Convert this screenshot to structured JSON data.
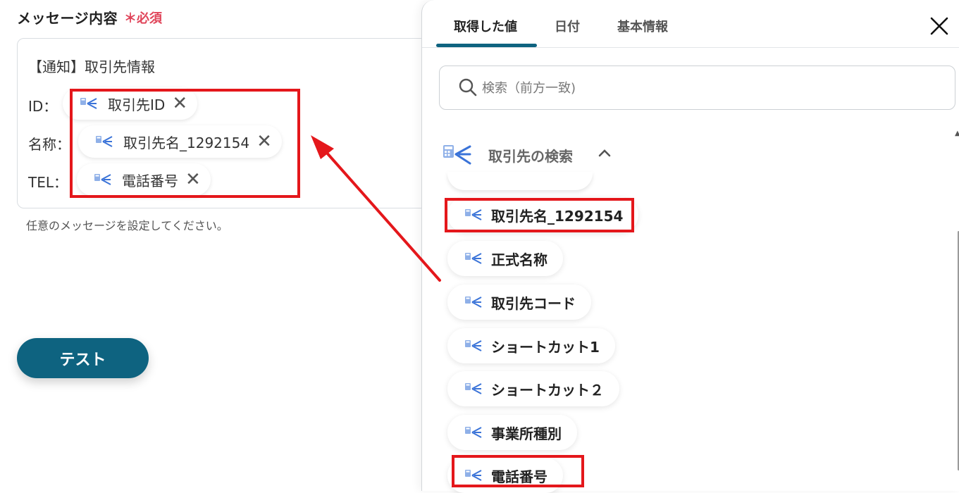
{
  "form": {
    "label": "メッセージ内容",
    "required_mark": "＊必須",
    "message_lines": [
      {
        "text": "【通知】取引先情報"
      },
      {
        "prefix": "ID：",
        "chip": "取引先ID"
      },
      {
        "prefix": "名称：",
        "chip": "取引先名_1292154"
      },
      {
        "prefix": "TEL：",
        "chip": "電話番号"
      }
    ],
    "hint": "任意のメッセージを設定してください。",
    "test_button": "テスト"
  },
  "panel": {
    "tabs": [
      {
        "label": "取得した値",
        "active": true
      },
      {
        "label": "日付",
        "active": false
      },
      {
        "label": "基本情報",
        "active": false
      }
    ],
    "search_placeholder": "検索（前方一致)",
    "section_title": "取引先の検索",
    "items": [
      "取引先名_1292154",
      "正式名称",
      "取引先コード",
      "ショートカット1",
      "ショートカット２",
      "事業所種別",
      "電話番号"
    ]
  },
  "colors": {
    "accent": "#0e6380",
    "required": "#e0455a",
    "highlight": "#e4171b",
    "icon_blue": "#3a73d8"
  },
  "icons": [
    "operation-icon",
    "remove-icon",
    "search-icon",
    "close-icon",
    "chevron-up-icon"
  ]
}
